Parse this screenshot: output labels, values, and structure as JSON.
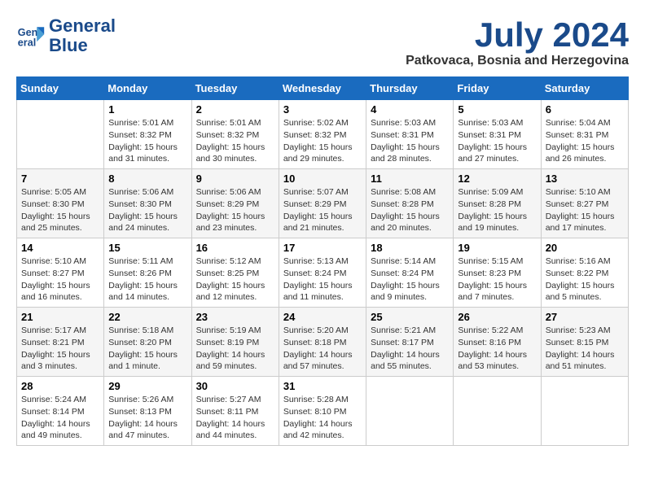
{
  "logo": {
    "line1": "General",
    "line2": "Blue"
  },
  "title": "July 2024",
  "location": "Patkovaca, Bosnia and Herzegovina",
  "days_of_week": [
    "Sunday",
    "Monday",
    "Tuesday",
    "Wednesday",
    "Thursday",
    "Friday",
    "Saturday"
  ],
  "weeks": [
    [
      {
        "day": "",
        "info": ""
      },
      {
        "day": "1",
        "info": "Sunrise: 5:01 AM\nSunset: 8:32 PM\nDaylight: 15 hours\nand 31 minutes."
      },
      {
        "day": "2",
        "info": "Sunrise: 5:01 AM\nSunset: 8:32 PM\nDaylight: 15 hours\nand 30 minutes."
      },
      {
        "day": "3",
        "info": "Sunrise: 5:02 AM\nSunset: 8:32 PM\nDaylight: 15 hours\nand 29 minutes."
      },
      {
        "day": "4",
        "info": "Sunrise: 5:03 AM\nSunset: 8:31 PM\nDaylight: 15 hours\nand 28 minutes."
      },
      {
        "day": "5",
        "info": "Sunrise: 5:03 AM\nSunset: 8:31 PM\nDaylight: 15 hours\nand 27 minutes."
      },
      {
        "day": "6",
        "info": "Sunrise: 5:04 AM\nSunset: 8:31 PM\nDaylight: 15 hours\nand 26 minutes."
      }
    ],
    [
      {
        "day": "7",
        "info": "Sunrise: 5:05 AM\nSunset: 8:30 PM\nDaylight: 15 hours\nand 25 minutes."
      },
      {
        "day": "8",
        "info": "Sunrise: 5:06 AM\nSunset: 8:30 PM\nDaylight: 15 hours\nand 24 minutes."
      },
      {
        "day": "9",
        "info": "Sunrise: 5:06 AM\nSunset: 8:29 PM\nDaylight: 15 hours\nand 23 minutes."
      },
      {
        "day": "10",
        "info": "Sunrise: 5:07 AM\nSunset: 8:29 PM\nDaylight: 15 hours\nand 21 minutes."
      },
      {
        "day": "11",
        "info": "Sunrise: 5:08 AM\nSunset: 8:28 PM\nDaylight: 15 hours\nand 20 minutes."
      },
      {
        "day": "12",
        "info": "Sunrise: 5:09 AM\nSunset: 8:28 PM\nDaylight: 15 hours\nand 19 minutes."
      },
      {
        "day": "13",
        "info": "Sunrise: 5:10 AM\nSunset: 8:27 PM\nDaylight: 15 hours\nand 17 minutes."
      }
    ],
    [
      {
        "day": "14",
        "info": "Sunrise: 5:10 AM\nSunset: 8:27 PM\nDaylight: 15 hours\nand 16 minutes."
      },
      {
        "day": "15",
        "info": "Sunrise: 5:11 AM\nSunset: 8:26 PM\nDaylight: 15 hours\nand 14 minutes."
      },
      {
        "day": "16",
        "info": "Sunrise: 5:12 AM\nSunset: 8:25 PM\nDaylight: 15 hours\nand 12 minutes."
      },
      {
        "day": "17",
        "info": "Sunrise: 5:13 AM\nSunset: 8:24 PM\nDaylight: 15 hours\nand 11 minutes."
      },
      {
        "day": "18",
        "info": "Sunrise: 5:14 AM\nSunset: 8:24 PM\nDaylight: 15 hours\nand 9 minutes."
      },
      {
        "day": "19",
        "info": "Sunrise: 5:15 AM\nSunset: 8:23 PM\nDaylight: 15 hours\nand 7 minutes."
      },
      {
        "day": "20",
        "info": "Sunrise: 5:16 AM\nSunset: 8:22 PM\nDaylight: 15 hours\nand 5 minutes."
      }
    ],
    [
      {
        "day": "21",
        "info": "Sunrise: 5:17 AM\nSunset: 8:21 PM\nDaylight: 15 hours\nand 3 minutes."
      },
      {
        "day": "22",
        "info": "Sunrise: 5:18 AM\nSunset: 8:20 PM\nDaylight: 15 hours\nand 1 minute."
      },
      {
        "day": "23",
        "info": "Sunrise: 5:19 AM\nSunset: 8:19 PM\nDaylight: 14 hours\nand 59 minutes."
      },
      {
        "day": "24",
        "info": "Sunrise: 5:20 AM\nSunset: 8:18 PM\nDaylight: 14 hours\nand 57 minutes."
      },
      {
        "day": "25",
        "info": "Sunrise: 5:21 AM\nSunset: 8:17 PM\nDaylight: 14 hours\nand 55 minutes."
      },
      {
        "day": "26",
        "info": "Sunrise: 5:22 AM\nSunset: 8:16 PM\nDaylight: 14 hours\nand 53 minutes."
      },
      {
        "day": "27",
        "info": "Sunrise: 5:23 AM\nSunset: 8:15 PM\nDaylight: 14 hours\nand 51 minutes."
      }
    ],
    [
      {
        "day": "28",
        "info": "Sunrise: 5:24 AM\nSunset: 8:14 PM\nDaylight: 14 hours\nand 49 minutes."
      },
      {
        "day": "29",
        "info": "Sunrise: 5:26 AM\nSunset: 8:13 PM\nDaylight: 14 hours\nand 47 minutes."
      },
      {
        "day": "30",
        "info": "Sunrise: 5:27 AM\nSunset: 8:11 PM\nDaylight: 14 hours\nand 44 minutes."
      },
      {
        "day": "31",
        "info": "Sunrise: 5:28 AM\nSunset: 8:10 PM\nDaylight: 14 hours\nand 42 minutes."
      },
      {
        "day": "",
        "info": ""
      },
      {
        "day": "",
        "info": ""
      },
      {
        "day": "",
        "info": ""
      }
    ]
  ]
}
